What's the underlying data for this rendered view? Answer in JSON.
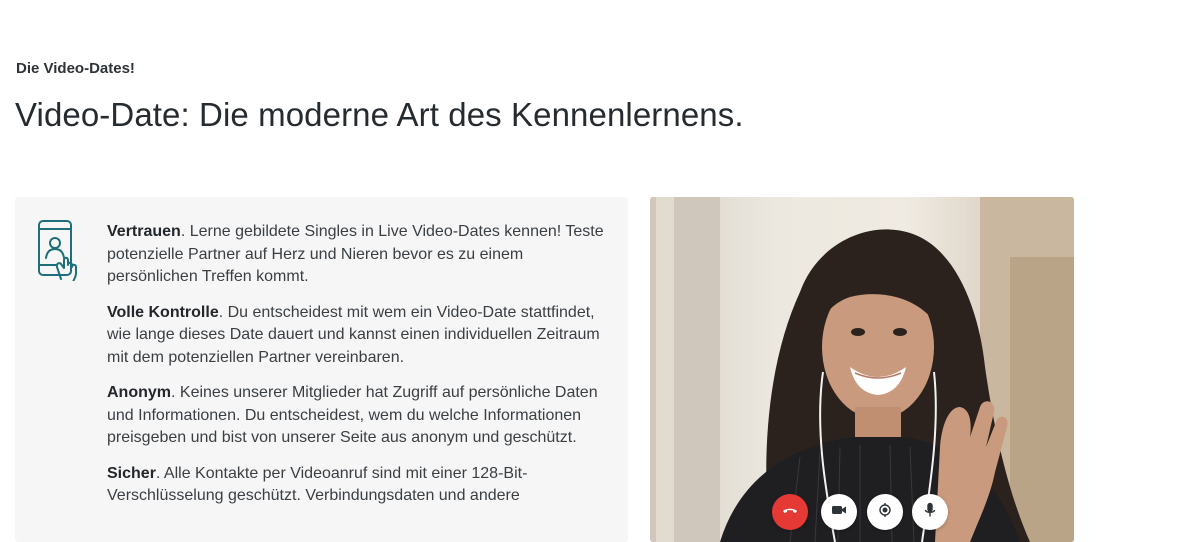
{
  "section": {
    "eyebrow": "Die Video-Dates!",
    "headline": "Video-Date: Die moderne Art des Kennenlernens."
  },
  "features": [
    {
      "title": "Vertrauen",
      "text": ". Lerne gebildete Singles in Live Video-Dates kennen! Teste potenzielle Partner auf Herz und Nieren bevor es zu einem persönlichen Treffen kommt."
    },
    {
      "title": "Volle Kontrolle",
      "text": ". Du entscheidest mit wem ein Video-Date stattfindet, wie lange dieses Date dauert und kannst einen individuellen Zeitraum mit dem potenziellen Partner vereinbaren."
    },
    {
      "title": "Anonym",
      "text": ". Keines unserer Mitglieder hat Zugriff auf persönliche Daten und Informationen. Du entscheidest, wem du welche Informationen preisgeben und bist von unserer Seite aus anonym und geschützt."
    },
    {
      "title": "Sicher",
      "text": ". Alle Kontakte per Videoanruf sind mit einer 128-Bit-Verschlüsselung geschützt. Verbindungsdaten und andere"
    }
  ],
  "icons": {
    "panel": "phone-video-call-icon",
    "hangup": "phone-hangup-icon",
    "camera": "video-camera-icon",
    "switch": "camera-switch-icon",
    "mic": "microphone-icon"
  },
  "colors": {
    "accent": "#1f6f7a",
    "hangup": "#e53935",
    "panel_bg": "#f6f6f6"
  }
}
